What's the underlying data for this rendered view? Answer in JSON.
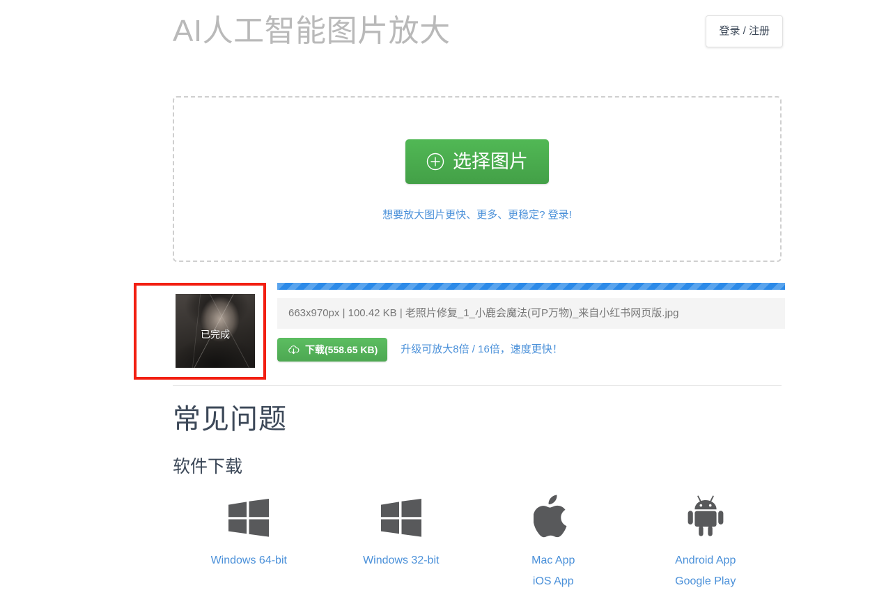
{
  "header": {
    "title": "AI人工智能图片放大",
    "login_label": "登录 / 注册"
  },
  "dropzone": {
    "select_button_label": "选择图片",
    "select_icon": "plus-circle-icon",
    "hint_text": "想要放大图片更快、更多、更稳定? 登录!"
  },
  "result": {
    "thumbnail_status": "已完成",
    "progress_percent": 100,
    "file_info": "663x970px | 100.42 KB | 老照片修复_1_小鹿会魔法(可P万物)_来自小红书网页版.jpg",
    "file_dimensions": "663x970px",
    "file_size": "100.42 KB",
    "file_name": "老照片修复_1_小鹿会魔法(可P万物)_来自小红书网页版.jpg",
    "download_label": "下载(558.65 KB)",
    "download_size": "558.65 KB",
    "download_icon": "cloud-download-icon",
    "upgrade_link": "升级可放大8倍 / 16倍，速度更快！",
    "highlight_color": "#f21f12"
  },
  "faq": {
    "title": "常见问题",
    "subtitle": "软件下载",
    "downloads": [
      {
        "icon": "windows-icon",
        "links": [
          "Windows 64-bit"
        ]
      },
      {
        "icon": "windows-icon",
        "links": [
          "Windows 32-bit"
        ]
      },
      {
        "icon": "apple-icon",
        "links": [
          "Mac App",
          "iOS App"
        ]
      },
      {
        "icon": "android-icon",
        "links": [
          "Android App",
          "Google Play"
        ]
      }
    ]
  },
  "colors": {
    "primary_green": "#4caf50",
    "link_blue": "#4a90d9",
    "progress_blue": "#2c8ae8",
    "title_gray": "#b9b9b9",
    "heading_dark": "#3c4858",
    "annotation_red": "#f21f12"
  }
}
